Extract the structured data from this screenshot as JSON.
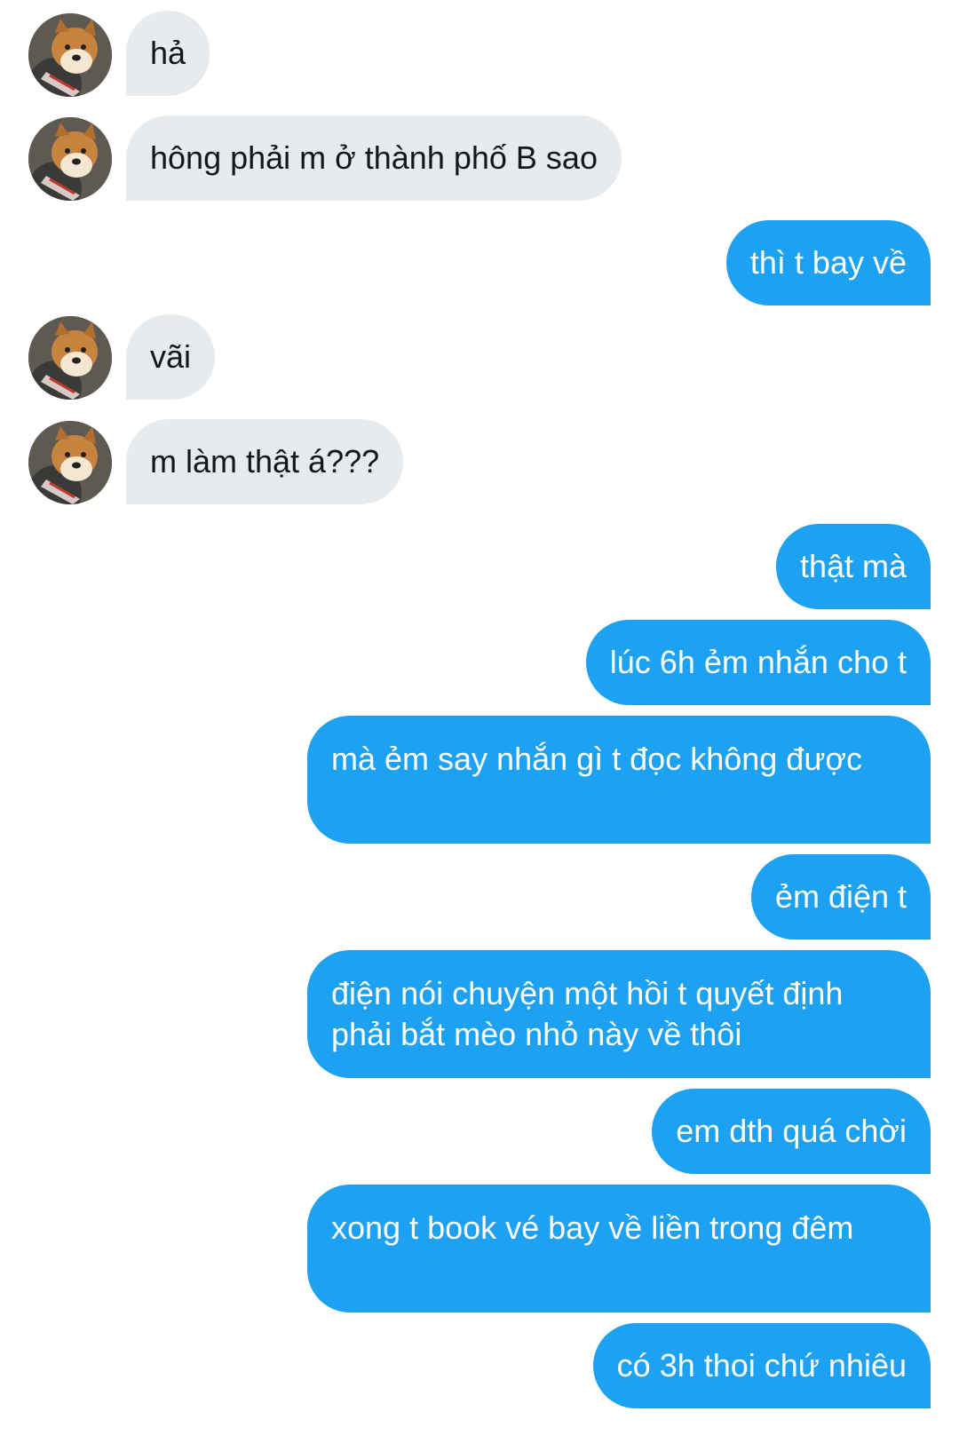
{
  "colors": {
    "incoming_bubble": "#e8ebee",
    "outgoing_bubble": "#1da1f2",
    "incoming_text": "#14171a",
    "outgoing_text": "#ffffff"
  },
  "contact": {
    "avatar_icon": "shiba-dog-avatar-icon"
  },
  "messages": [
    {
      "from": "them",
      "text": "hả"
    },
    {
      "from": "them",
      "text": "hông phải m ở thành phố B sao"
    },
    {
      "from": "me",
      "text": "thì t bay về"
    },
    {
      "from": "them",
      "text": "vãi"
    },
    {
      "from": "them",
      "text": "m làm thật á???"
    },
    {
      "from": "me",
      "text": "thật mà"
    },
    {
      "from": "me",
      "text": "lúc 6h ẻm nhắn cho t"
    },
    {
      "from": "me",
      "text": "mà ẻm say nhắn gì t đọc không được"
    },
    {
      "from": "me",
      "text": "ẻm điện t"
    },
    {
      "from": "me",
      "text": "điện nói chuyện một hồi t quyết định phải bắt mèo nhỏ này về thôi"
    },
    {
      "from": "me",
      "text": "em dth quá chời"
    },
    {
      "from": "me",
      "text": "xong t book vé bay về liền trong đêm"
    },
    {
      "from": "me",
      "text": "có 3h thoi chứ nhiêu"
    }
  ]
}
